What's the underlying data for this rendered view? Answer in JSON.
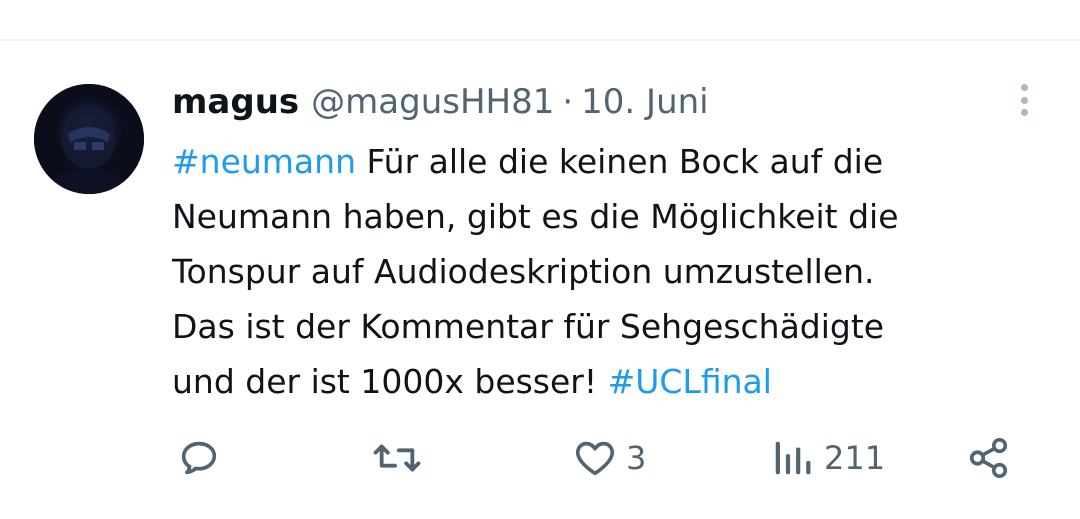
{
  "tweet": {
    "author": {
      "name": "magus",
      "handle": "@magusHH81"
    },
    "separator": "·",
    "date": "10. Juni",
    "text_lines": [
      {
        "hashtag": "#neumann",
        "text": " Für alle die keinen Bock auf die"
      },
      {
        "text": "Neumann haben, gibt es die Möglichkeit die"
      },
      {
        "text": "Tonspur auf Audiodeskription umzustellen."
      },
      {
        "text": "Das ist der Kommentar für Sehgeschädigte"
      },
      {
        "text": "und der ist 1000x besser! ",
        "hashtag_end": "#UCLfinal"
      }
    ]
  },
  "actions": {
    "reply_icon": "reply-icon",
    "retweet_icon": "retweet-icon",
    "like_icon": "heart-icon",
    "like_count": "3",
    "views_icon": "views-chart-icon",
    "views_count": "211",
    "share_icon": "share-icon"
  },
  "colors": {
    "text": "#0f1419",
    "secondary": "#536471",
    "link": "#1d9bf0",
    "divider": "#eff3f4"
  }
}
